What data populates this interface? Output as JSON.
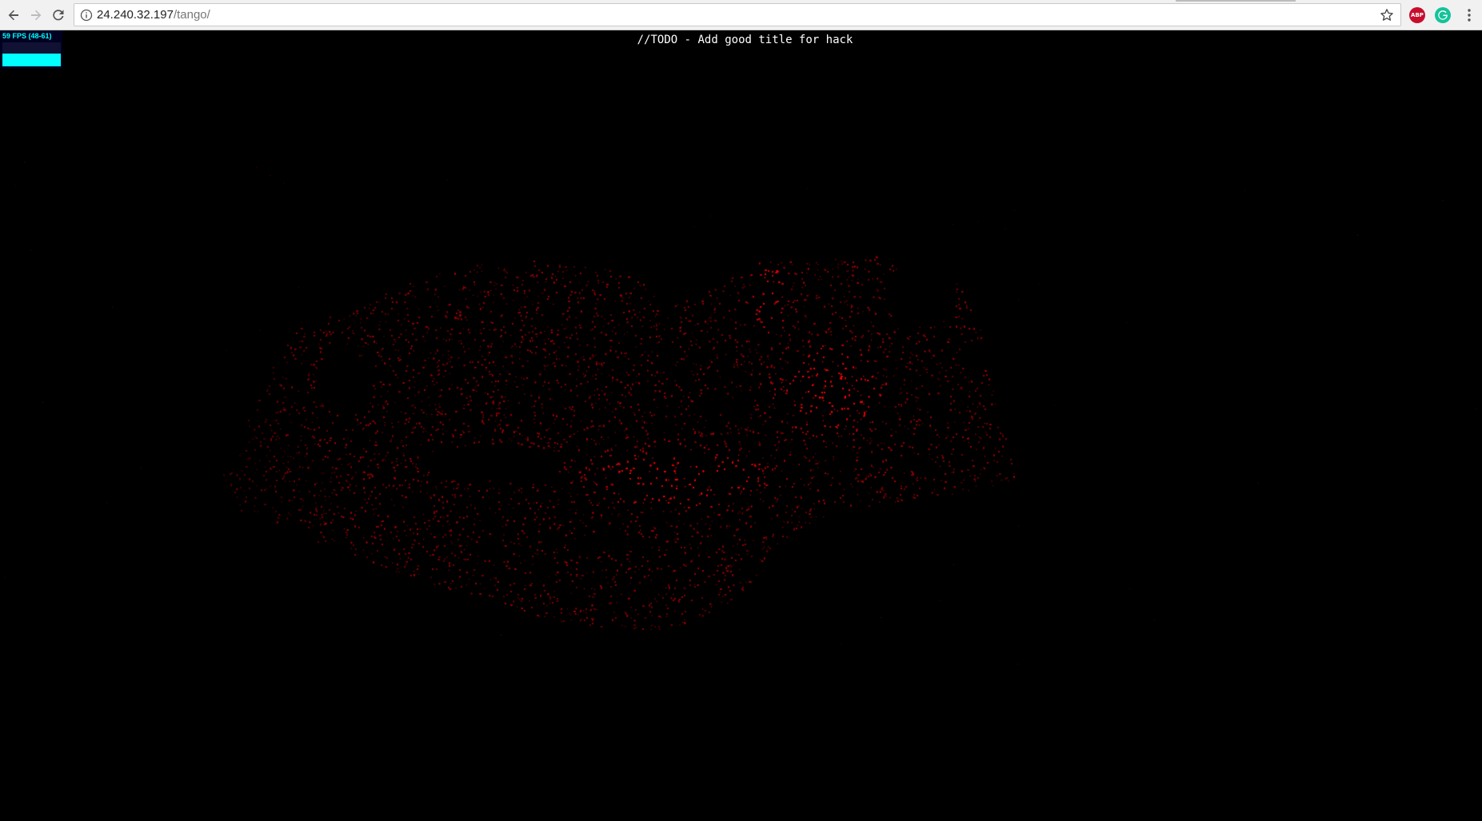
{
  "browser": {
    "url_host": "24.240.32.197",
    "url_path": "/tango/",
    "icons": {
      "back": "back-arrow-icon",
      "forward": "forward-arrow-icon",
      "reload": "reload-icon",
      "info": "info-icon",
      "bookmark": "star-icon",
      "adblock": "adblock-plus-icon",
      "grammarly": "grammarly-icon",
      "menu": "kebab-menu-icon"
    },
    "adblock_label": "ABP"
  },
  "stats": {
    "fps_label": "59 FPS (48-61)",
    "fps_level": 0.55,
    "color": "#00ffff"
  },
  "page": {
    "title": "//TODO - Add good title for hack",
    "background": "#000000",
    "point_color": "#ff0000"
  }
}
